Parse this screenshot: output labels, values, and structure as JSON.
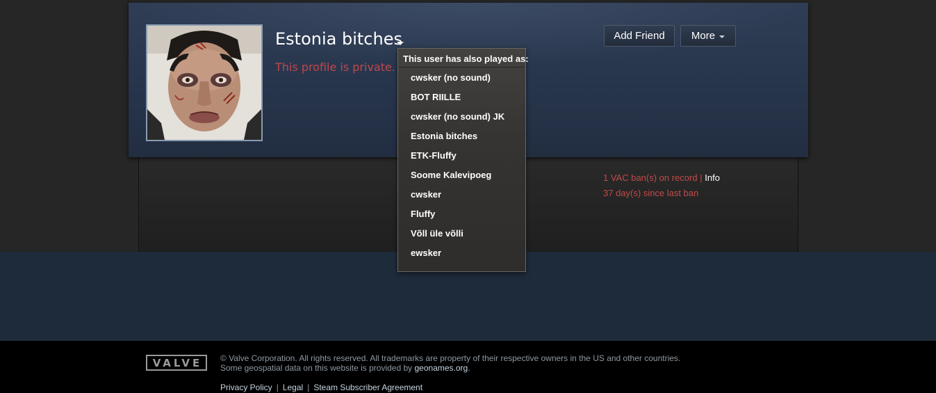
{
  "profile": {
    "persona_name": "Estonia bitches",
    "private_message": "This profile is private.",
    "avatar_icon": "user-avatar-image"
  },
  "header_actions": {
    "add_friend_label": "Add Friend",
    "more_label": "More"
  },
  "alias_dropdown": {
    "heading": "This user has also played as:",
    "aliases": [
      "cwsker (no sound)",
      "BOT RIILLE",
      "cwsker (no sound) JK",
      "Estonia bitches",
      "ETK-Fluffy",
      "Soome Kalevipoeg",
      "cwsker",
      "Fluffy",
      "Võll üle võlli",
      "ewsker"
    ]
  },
  "ban_status": {
    "vac_bans": "1 VAC ban(s) on record",
    "separator": "|",
    "info_link": "Info",
    "days_since": "37 day(s) since last ban"
  },
  "footer": {
    "logo_text": "VALVE",
    "copyright": "© Valve Corporation. All rights reserved. All trademarks are property of their respective owners in the US and other countries.",
    "geo_text": "Some geospatial data on this website is provided by ",
    "geo_link": "geonames.org",
    "geo_period": ".",
    "links": [
      "Privacy Policy",
      "Legal",
      "Steam Subscriber Agreement"
    ],
    "link_separator": "|"
  },
  "colors": {
    "header_blue": "#2f3d55",
    "private_red": "#c0464b",
    "ban_red": "#c24a4a",
    "page_lower": "#1e2b3a"
  }
}
